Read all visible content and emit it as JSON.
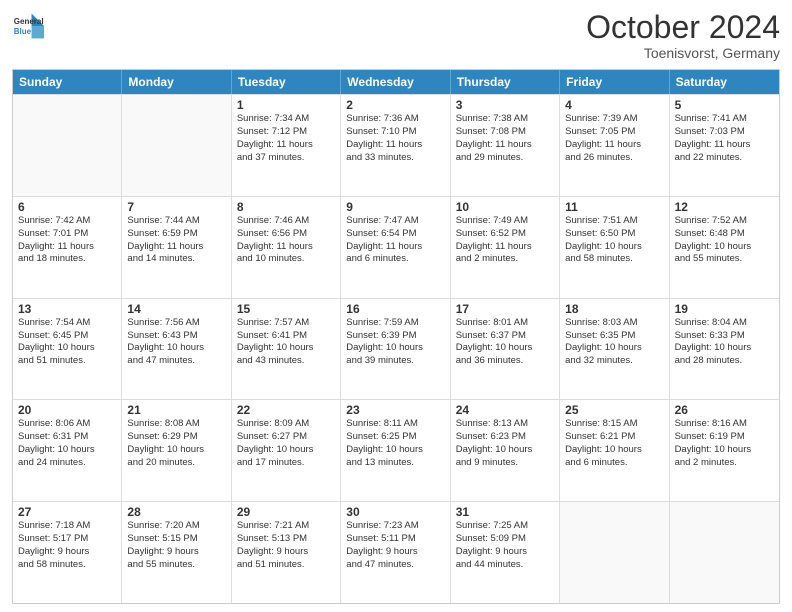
{
  "header": {
    "logo_line1": "General",
    "logo_line2": "Blue",
    "month": "October 2024",
    "location": "Toenisvorst, Germany"
  },
  "weekdays": [
    "Sunday",
    "Monday",
    "Tuesday",
    "Wednesday",
    "Thursday",
    "Friday",
    "Saturday"
  ],
  "rows": [
    [
      {
        "day": "",
        "info": ""
      },
      {
        "day": "",
        "info": ""
      },
      {
        "day": "1",
        "info": "Sunrise: 7:34 AM\nSunset: 7:12 PM\nDaylight: 11 hours\nand 37 minutes."
      },
      {
        "day": "2",
        "info": "Sunrise: 7:36 AM\nSunset: 7:10 PM\nDaylight: 11 hours\nand 33 minutes."
      },
      {
        "day": "3",
        "info": "Sunrise: 7:38 AM\nSunset: 7:08 PM\nDaylight: 11 hours\nand 29 minutes."
      },
      {
        "day": "4",
        "info": "Sunrise: 7:39 AM\nSunset: 7:05 PM\nDaylight: 11 hours\nand 26 minutes."
      },
      {
        "day": "5",
        "info": "Sunrise: 7:41 AM\nSunset: 7:03 PM\nDaylight: 11 hours\nand 22 minutes."
      }
    ],
    [
      {
        "day": "6",
        "info": "Sunrise: 7:42 AM\nSunset: 7:01 PM\nDaylight: 11 hours\nand 18 minutes."
      },
      {
        "day": "7",
        "info": "Sunrise: 7:44 AM\nSunset: 6:59 PM\nDaylight: 11 hours\nand 14 minutes."
      },
      {
        "day": "8",
        "info": "Sunrise: 7:46 AM\nSunset: 6:56 PM\nDaylight: 11 hours\nand 10 minutes."
      },
      {
        "day": "9",
        "info": "Sunrise: 7:47 AM\nSunset: 6:54 PM\nDaylight: 11 hours\nand 6 minutes."
      },
      {
        "day": "10",
        "info": "Sunrise: 7:49 AM\nSunset: 6:52 PM\nDaylight: 11 hours\nand 2 minutes."
      },
      {
        "day": "11",
        "info": "Sunrise: 7:51 AM\nSunset: 6:50 PM\nDaylight: 10 hours\nand 58 minutes."
      },
      {
        "day": "12",
        "info": "Sunrise: 7:52 AM\nSunset: 6:48 PM\nDaylight: 10 hours\nand 55 minutes."
      }
    ],
    [
      {
        "day": "13",
        "info": "Sunrise: 7:54 AM\nSunset: 6:45 PM\nDaylight: 10 hours\nand 51 minutes."
      },
      {
        "day": "14",
        "info": "Sunrise: 7:56 AM\nSunset: 6:43 PM\nDaylight: 10 hours\nand 47 minutes."
      },
      {
        "day": "15",
        "info": "Sunrise: 7:57 AM\nSunset: 6:41 PM\nDaylight: 10 hours\nand 43 minutes."
      },
      {
        "day": "16",
        "info": "Sunrise: 7:59 AM\nSunset: 6:39 PM\nDaylight: 10 hours\nand 39 minutes."
      },
      {
        "day": "17",
        "info": "Sunrise: 8:01 AM\nSunset: 6:37 PM\nDaylight: 10 hours\nand 36 minutes."
      },
      {
        "day": "18",
        "info": "Sunrise: 8:03 AM\nSunset: 6:35 PM\nDaylight: 10 hours\nand 32 minutes."
      },
      {
        "day": "19",
        "info": "Sunrise: 8:04 AM\nSunset: 6:33 PM\nDaylight: 10 hours\nand 28 minutes."
      }
    ],
    [
      {
        "day": "20",
        "info": "Sunrise: 8:06 AM\nSunset: 6:31 PM\nDaylight: 10 hours\nand 24 minutes."
      },
      {
        "day": "21",
        "info": "Sunrise: 8:08 AM\nSunset: 6:29 PM\nDaylight: 10 hours\nand 20 minutes."
      },
      {
        "day": "22",
        "info": "Sunrise: 8:09 AM\nSunset: 6:27 PM\nDaylight: 10 hours\nand 17 minutes."
      },
      {
        "day": "23",
        "info": "Sunrise: 8:11 AM\nSunset: 6:25 PM\nDaylight: 10 hours\nand 13 minutes."
      },
      {
        "day": "24",
        "info": "Sunrise: 8:13 AM\nSunset: 6:23 PM\nDaylight: 10 hours\nand 9 minutes."
      },
      {
        "day": "25",
        "info": "Sunrise: 8:15 AM\nSunset: 6:21 PM\nDaylight: 10 hours\nand 6 minutes."
      },
      {
        "day": "26",
        "info": "Sunrise: 8:16 AM\nSunset: 6:19 PM\nDaylight: 10 hours\nand 2 minutes."
      }
    ],
    [
      {
        "day": "27",
        "info": "Sunrise: 7:18 AM\nSunset: 5:17 PM\nDaylight: 9 hours\nand 58 minutes."
      },
      {
        "day": "28",
        "info": "Sunrise: 7:20 AM\nSunset: 5:15 PM\nDaylight: 9 hours\nand 55 minutes."
      },
      {
        "day": "29",
        "info": "Sunrise: 7:21 AM\nSunset: 5:13 PM\nDaylight: 9 hours\nand 51 minutes."
      },
      {
        "day": "30",
        "info": "Sunrise: 7:23 AM\nSunset: 5:11 PM\nDaylight: 9 hours\nand 47 minutes."
      },
      {
        "day": "31",
        "info": "Sunrise: 7:25 AM\nSunset: 5:09 PM\nDaylight: 9 hours\nand 44 minutes."
      },
      {
        "day": "",
        "info": ""
      },
      {
        "day": "",
        "info": ""
      }
    ]
  ]
}
